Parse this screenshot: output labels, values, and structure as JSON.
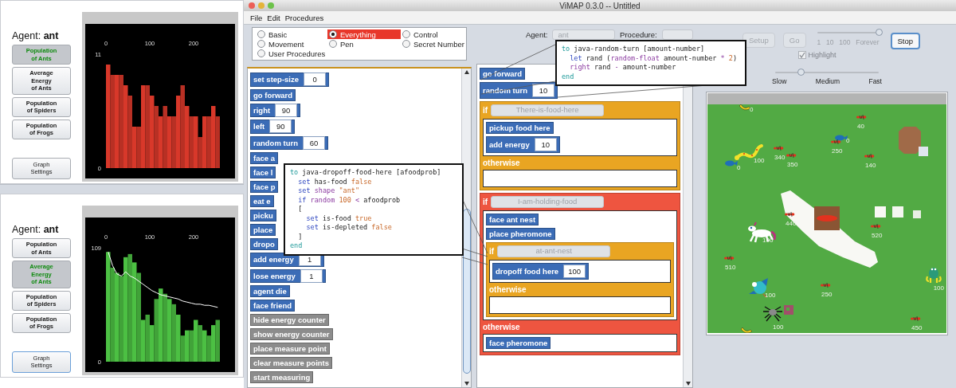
{
  "graphs": [
    {
      "agent_label": "Agent: **ant**",
      "buttons": [
        {
          "label": "Population\nof Ants",
          "selected": true
        },
        {
          "label": "Average\nEnergy\nof Ants",
          "selected": false
        },
        {
          "label": "Population\nof Spiders",
          "selected": false
        },
        {
          "label": "Population\nof Frogs",
          "selected": false
        }
      ],
      "settings_button": {
        "label": "Graph\nSettings",
        "focused": false
      },
      "chart_data": {
        "type": "bar",
        "x": [
          0,
          10,
          20,
          30,
          40,
          50,
          60,
          70,
          80,
          90,
          100,
          110,
          120,
          130,
          140,
          150,
          160,
          170,
          180,
          190,
          200,
          210,
          220,
          230,
          240,
          250
        ],
        "xlim": [
          0,
          260
        ],
        "ylim": [
          0,
          11
        ],
        "xticks": [
          0,
          100,
          200
        ],
        "yticks": [
          0,
          11
        ],
        "series": [
          {
            "color": "#d8382a",
            "values": [
              10,
              9,
              9,
              9,
              8,
              7,
              4,
              4,
              8,
              8,
              7,
              6,
              5,
              6,
              5,
              5,
              7,
              8,
              6,
              5,
              5,
              3,
              5,
              5,
              6,
              5
            ]
          }
        ]
      }
    },
    {
      "agent_label": "Agent: **ant**",
      "buttons": [
        {
          "label": "Population\nof Ants",
          "selected": false
        },
        {
          "label": "Average\nEnergy\nof Ants",
          "selected": true
        },
        {
          "label": "Population\nof Spiders",
          "selected": false
        },
        {
          "label": "Population\nof Frogs",
          "selected": false
        }
      ],
      "settings_button": {
        "label": "Graph\nSettings",
        "focused": true
      },
      "chart_data": {
        "type": "bar",
        "x": [
          0,
          10,
          20,
          30,
          40,
          50,
          60,
          70,
          80,
          90,
          100,
          110,
          120,
          130,
          140,
          150,
          160,
          170,
          180,
          190,
          200,
          210,
          220,
          230,
          240,
          250
        ],
        "xlim": [
          0,
          260
        ],
        "ylim": [
          0,
          109
        ],
        "xticks": [
          0,
          100,
          200
        ],
        "yticks": [
          0,
          109
        ],
        "series": [
          {
            "color": "#4cc043",
            "values": [
              105,
              90,
              85,
              82,
              100,
              103,
              95,
              85,
              40,
              45,
              35,
              60,
              70,
              65,
              60,
              55,
              45,
              25,
              30,
              30,
              40,
              35,
              30,
              25,
              35,
              40
            ]
          },
          {
            "color": "#ffffff",
            "type": "line",
            "values": [
              105,
              92,
              84,
              82,
              86,
              82,
              80,
              77,
              74,
              71,
              68,
              66,
              64,
              63,
              62,
              61,
              60,
              58,
              57,
              56,
              55,
              55,
              54,
              54,
              53,
              52
            ]
          }
        ]
      }
    }
  ],
  "window": {
    "title": "ViMAP 0.3.0 -- Untitled"
  },
  "menu": [
    "File",
    "Edit",
    "Procedures"
  ],
  "categories": [
    {
      "label": "Basic",
      "selected": false
    },
    {
      "label": "Everything",
      "selected": true
    },
    {
      "label": "Control",
      "selected": false
    },
    {
      "label": "Movement",
      "selected": false
    },
    {
      "label": "Pen",
      "selected": false
    },
    {
      "label": "Secret Number",
      "selected": false
    },
    {
      "label": "User Procedures",
      "selected": false
    }
  ],
  "palette": [
    {
      "label": "set step-size",
      "value": "0",
      "color": "#3b6cb6"
    },
    {
      "label": "go forward",
      "color": "#3b6cb6"
    },
    {
      "label": "right",
      "value": "90",
      "color": "#3b6cb6"
    },
    {
      "label": "left",
      "value": "90",
      "color": "#3b6cb6"
    },
    {
      "label": "random turn",
      "value": "60",
      "color": "#3b6cb6"
    },
    {
      "label": "face a",
      "color": "#3b6cb6"
    },
    {
      "label": "face l",
      "color": "#3b6cb6"
    },
    {
      "label": "face p",
      "color": "#3b6cb6"
    },
    {
      "label": "eat e",
      "color": "#3b6cb6"
    },
    {
      "label": "picku",
      "color": "#3b6cb6"
    },
    {
      "label": "place",
      "color": "#3b6cb6"
    },
    {
      "label": "dropo",
      "color": "#3b6cb6"
    },
    {
      "label": "add energy",
      "value": "1",
      "color": "#3b6cb6"
    },
    {
      "label": "lose energy",
      "value": "1",
      "color": "#3b6cb6"
    },
    {
      "label": "agent die",
      "color": "#3b6cb6"
    },
    {
      "label": "face friend",
      "color": "#3b6cb6"
    },
    {
      "label": "hide energy counter",
      "color": "#8c8c8c"
    },
    {
      "label": "show energy counter",
      "color": "#8c8c8c"
    },
    {
      "label": "place measure point",
      "color": "#8c8c8c"
    },
    {
      "label": "clear measure points",
      "color": "#8c8c8c"
    },
    {
      "label": "start measuring",
      "color": "#8c8c8c"
    }
  ],
  "agent_selector": {
    "label": "Agent:",
    "value": "ant",
    "disabled": true
  },
  "procedure_selector": {
    "label": "Procedure:"
  },
  "program": [
    {
      "kind": "command",
      "label": "go forward"
    },
    {
      "kind": "command",
      "label": "random turn",
      "value": "10"
    },
    {
      "kind": "if",
      "keyword": "if",
      "color": "#e9a522",
      "condition": "There-is-food-here",
      "then": [
        {
          "kind": "command",
          "label": "pickup food here"
        },
        {
          "kind": "command",
          "label": "add energy",
          "value": "10"
        }
      ],
      "otherwise_label": "otherwise"
    },
    {
      "kind": "if",
      "keyword": "if",
      "color": "#ee5540",
      "condition": "I-am-holding-food",
      "then": [
        {
          "kind": "command",
          "label": "face ant nest"
        },
        {
          "kind": "command",
          "label": "place pheromone"
        },
        {
          "kind": "if",
          "keyword": "if",
          "color": "#e9a522",
          "condition": "at-ant-nest",
          "then": [
            {
              "kind": "command",
              "label": "dropoff food here",
              "value": "100"
            }
          ],
          "otherwise_label": "otherwise"
        }
      ],
      "otherwise_label": "otherwise",
      "otherwise": [
        {
          "kind": "command",
          "label": "face pheromone"
        }
      ]
    }
  ],
  "controls": {
    "setup": {
      "label": "Setup",
      "disabled": true
    },
    "go": {
      "label": "Go",
      "disabled": true
    },
    "run_slider": {
      "ticks": [
        "1",
        "10",
        "100",
        "Forever"
      ],
      "level": 1
    },
    "stop": {
      "label": "Stop",
      "disabled": false
    },
    "highlight": {
      "label": "Highlight",
      "checked": true,
      "disabled": true
    }
  },
  "speed_slider": {
    "labels": [
      "Slow",
      "Medium",
      "Fast"
    ],
    "level": 0.25
  },
  "world": {
    "agents": [
      {
        "kind": "banana",
        "label": "0"
      },
      {
        "kind": "ant",
        "label": "40"
      },
      {
        "kind": "fish",
        "label": "0"
      },
      {
        "kind": "ant",
        "label": "250"
      },
      {
        "kind": "snake",
        "label": "100"
      },
      {
        "kind": "ant",
        "label": "340"
      },
      {
        "kind": "ant",
        "label": "350"
      },
      {
        "kind": "fish",
        "label": "0"
      },
      {
        "kind": "ant",
        "label": "140"
      },
      {
        "kind": "ant",
        "label": "440"
      },
      {
        "kind": "unicorn",
        "label": "100"
      },
      {
        "kind": "ant",
        "label": "520"
      },
      {
        "kind": "ant",
        "label": "510"
      },
      {
        "kind": "bird",
        "label": "100"
      },
      {
        "kind": "ant",
        "label": "250"
      },
      {
        "kind": "frog",
        "label": "100"
      },
      {
        "kind": "spider",
        "label": "100"
      },
      {
        "kind": "ant",
        "label": "450"
      },
      {
        "kind": "banana"
      }
    ]
  },
  "code_popups": [
    {
      "lines": [
        [
          {
            "kind": "keyword",
            "text": "to"
          },
          {
            "kind": "plain",
            "text": " java-dropoff-food-here [afoodprob]"
          }
        ],
        [
          {
            "kind": "command",
            "text": "  set"
          },
          {
            "kind": "plain",
            "text": " has-food "
          },
          {
            "kind": "constant",
            "text": "false"
          }
        ],
        [
          {
            "kind": "command",
            "text": "  set"
          },
          {
            "kind": "reporter",
            "text": " shape "
          },
          {
            "kind": "constant",
            "text": "\"ant\""
          }
        ],
        [
          {
            "kind": "command",
            "text": "  if"
          },
          {
            "kind": "reporter",
            "text": " random "
          },
          {
            "kind": "constant",
            "text": "100"
          },
          {
            "kind": "reporter",
            "text": " < "
          },
          {
            "kind": "plain",
            "text": "afoodprob"
          }
        ],
        [
          {
            "kind": "plain",
            "text": "  ["
          }
        ],
        [
          {
            "kind": "command",
            "text": "    set"
          },
          {
            "kind": "plain",
            "text": " is-food "
          },
          {
            "kind": "constant",
            "text": "true"
          }
        ],
        [
          {
            "kind": "command",
            "text": "    set"
          },
          {
            "kind": "plain",
            "text": " is-depleted "
          },
          {
            "kind": "constant",
            "text": "false"
          }
        ],
        [
          {
            "kind": "plain",
            "text": "  ]"
          }
        ],
        [
          {
            "kind": "keyword",
            "text": "end"
          }
        ]
      ]
    },
    {
      "lines": [
        [
          {
            "kind": "keyword",
            "text": "to"
          },
          {
            "kind": "plain",
            "text": " java-random-turn [amount-number]"
          }
        ],
        [
          {
            "kind": "command",
            "text": "  let"
          },
          {
            "kind": "plain",
            "text": " rand ("
          },
          {
            "kind": "reporter",
            "text": "random-float"
          },
          {
            "kind": "plain",
            "text": " amount-number "
          },
          {
            "kind": "reporter",
            "text": "*"
          },
          {
            "kind": "constant",
            "text": " 2"
          },
          {
            "kind": "plain",
            "text": ")"
          }
        ],
        [
          {
            "kind": "reporter",
            "text": "  right"
          },
          {
            "kind": "plain",
            "text": " rand "
          },
          {
            "kind": "reporter",
            "text": "-"
          },
          {
            "kind": "plain",
            "text": " amount-number"
          }
        ],
        [
          {
            "kind": "keyword",
            "text": "end"
          }
        ]
      ]
    }
  ]
}
